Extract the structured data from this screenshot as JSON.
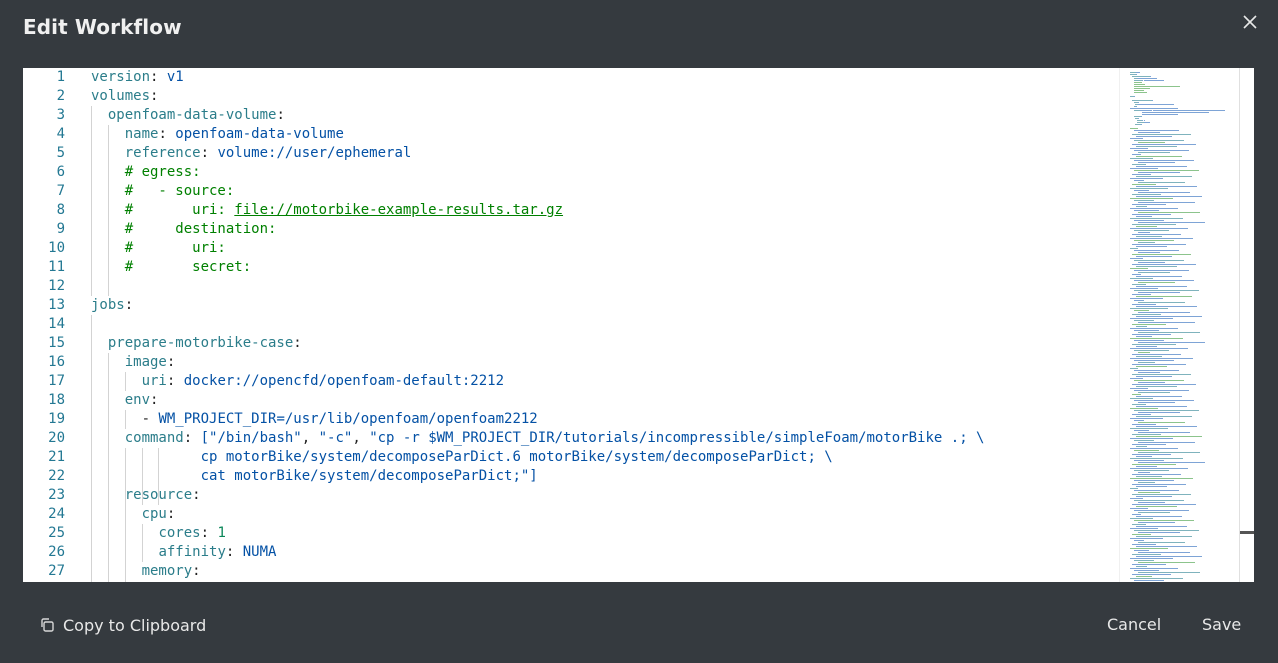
{
  "dialog": {
    "title": "Edit Workflow",
    "close_icon": "close-icon"
  },
  "editor": {
    "language": "yaml",
    "lines": [
      {
        "n": "1",
        "tokens": [
          [
            "k",
            "version"
          ],
          [
            "p",
            ": "
          ],
          [
            "v",
            "v1"
          ]
        ]
      },
      {
        "n": "2",
        "tokens": [
          [
            "k",
            "volumes"
          ],
          [
            "p",
            ":"
          ]
        ]
      },
      {
        "n": "3",
        "tokens": [
          [
            "p",
            "  "
          ],
          [
            "k",
            "openfoam-data-volume"
          ],
          [
            "p",
            ":"
          ]
        ]
      },
      {
        "n": "4",
        "tokens": [
          [
            "p",
            "    "
          ],
          [
            "k",
            "name"
          ],
          [
            "p",
            ": "
          ],
          [
            "v",
            "openfoam-data-volume"
          ]
        ]
      },
      {
        "n": "5",
        "tokens": [
          [
            "p",
            "    "
          ],
          [
            "k",
            "reference"
          ],
          [
            "p",
            ": "
          ],
          [
            "v",
            "volume://user/ephemeral"
          ]
        ]
      },
      {
        "n": "6",
        "tokens": [
          [
            "p",
            "    "
          ],
          [
            "c",
            "# egress:"
          ]
        ]
      },
      {
        "n": "7",
        "tokens": [
          [
            "p",
            "    "
          ],
          [
            "c",
            "#   - source:"
          ]
        ]
      },
      {
        "n": "8",
        "tokens": [
          [
            "p",
            "    "
          ],
          [
            "c",
            "#       uri: "
          ],
          [
            "cl",
            "file://motorbike-example-results.tar.gz"
          ]
        ]
      },
      {
        "n": "9",
        "tokens": [
          [
            "p",
            "    "
          ],
          [
            "c",
            "#     destination:"
          ]
        ]
      },
      {
        "n": "10",
        "tokens": [
          [
            "p",
            "    "
          ],
          [
            "c",
            "#       uri:"
          ]
        ]
      },
      {
        "n": "11",
        "tokens": [
          [
            "p",
            "    "
          ],
          [
            "c",
            "#       secret:"
          ]
        ]
      },
      {
        "n": "12",
        "tokens": []
      },
      {
        "n": "13",
        "tokens": [
          [
            "k",
            "jobs"
          ],
          [
            "p",
            ":"
          ]
        ]
      },
      {
        "n": "14",
        "tokens": []
      },
      {
        "n": "15",
        "tokens": [
          [
            "p",
            "  "
          ],
          [
            "k",
            "prepare-motorbike-case"
          ],
          [
            "p",
            ":"
          ]
        ]
      },
      {
        "n": "16",
        "tokens": [
          [
            "p",
            "    "
          ],
          [
            "k",
            "image"
          ],
          [
            "p",
            ":"
          ]
        ]
      },
      {
        "n": "17",
        "tokens": [
          [
            "p",
            "      "
          ],
          [
            "k",
            "uri"
          ],
          [
            "p",
            ": "
          ],
          [
            "v",
            "docker://opencfd/openfoam-default:2212"
          ]
        ]
      },
      {
        "n": "18",
        "tokens": [
          [
            "p",
            "    "
          ],
          [
            "k",
            "env"
          ],
          [
            "p",
            ":"
          ]
        ]
      },
      {
        "n": "19",
        "tokens": [
          [
            "p",
            "      - "
          ],
          [
            "v",
            "WM_PROJECT_DIR=/usr/lib/openfoam/openfoam2212"
          ]
        ]
      },
      {
        "n": "20",
        "tokens": [
          [
            "p",
            "    "
          ],
          [
            "k",
            "command"
          ],
          [
            "p",
            ": "
          ],
          [
            "v",
            "[\"/bin/bash\""
          ],
          [
            "p",
            ", "
          ],
          [
            "v",
            "\"-c\""
          ],
          [
            "p",
            ", "
          ],
          [
            "v",
            "\"cp -r $WM_PROJECT_DIR/tutorials/incompressible/simpleFoam/motorBike .; \\"
          ]
        ]
      },
      {
        "n": "21",
        "tokens": [
          [
            "p",
            "             "
          ],
          [
            "v",
            "cp motorBike/system/decomposeParDict.6 motorBike/system/decomposeParDict; \\"
          ]
        ]
      },
      {
        "n": "22",
        "tokens": [
          [
            "p",
            "             "
          ],
          [
            "v",
            "cat motorBike/system/decomposeParDict;\"]"
          ]
        ]
      },
      {
        "n": "23",
        "tokens": [
          [
            "p",
            "    "
          ],
          [
            "k",
            "resource"
          ],
          [
            "p",
            ":"
          ]
        ]
      },
      {
        "n": "24",
        "tokens": [
          [
            "p",
            "      "
          ],
          [
            "k",
            "cpu"
          ],
          [
            "p",
            ":"
          ]
        ]
      },
      {
        "n": "25",
        "tokens": [
          [
            "p",
            "        "
          ],
          [
            "k",
            "cores"
          ],
          [
            "p",
            ": "
          ],
          [
            "n",
            "1"
          ]
        ]
      },
      {
        "n": "26",
        "tokens": [
          [
            "p",
            "        "
          ],
          [
            "k",
            "affinity"
          ],
          [
            "p",
            ": "
          ],
          [
            "v",
            "NUMA"
          ]
        ]
      },
      {
        "n": "27",
        "tokens": [
          [
            "p",
            "      "
          ],
          [
            "k",
            "memory"
          ],
          [
            "p",
            ":"
          ]
        ]
      }
    ]
  },
  "footer": {
    "copy_label": "Copy to Clipboard",
    "copy_icon": "copy-icon",
    "cancel_label": "Cancel",
    "save_label": "Save"
  }
}
